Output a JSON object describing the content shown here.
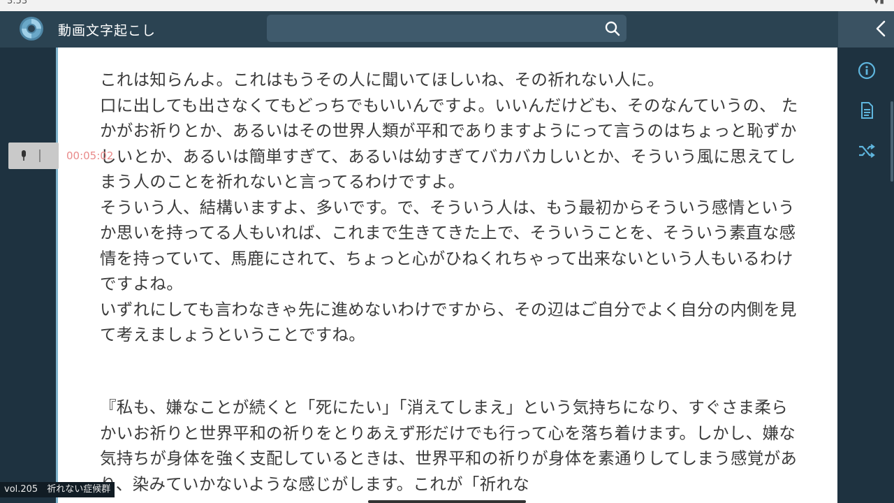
{
  "status_bar": {
    "time": "3:53"
  },
  "header": {
    "app_title": "動画文字起こし",
    "search_placeholder": ""
  },
  "player": {
    "timestamp": "00:05:02"
  },
  "footer": {
    "episode_label": "vol.205　祈れない症候群"
  },
  "transcript": {
    "paragraph1": "これは知らんよ。これはもうその人に聞いてほしいね、その祈れない人に。\n口に出しても出さなくてもどっちでもいいんですよ。いいんだけども、そのなんていうの、 たかがお祈りとか、あるいはその世界人類が平和でありますようにって言うのはちょっと恥ずかしいとか、あるいは簡単すぎて、あるいは幼すぎてバカバカしいとか、そういう風に思えてしまう人のことを祈れないと言ってるわけですよ。\nそういう人、結構いますよ、多いです。で、そういう人は、もう最初からそういう感情というか思いを持ってる人もいれば、これまで生きてきた上で、そういうことを、そういう素直な感情を持っていて、馬鹿にされて、ちょっと心がひねくれちゃって出来ないという人もいるわけですよね。\nいずれにしても言わなきゃ先に進めないわけですから、その辺はご自分でよく自分の内側を見て考えましょうということですね。",
    "paragraph2": "『私も、嫌なことが続くと「死にたい」「消えてしまえ」という気持ちになり、すぐさま柔らかいお祈りと世界平和の祈りをとりあえず形だけでも行って心を落ち着けます。しかし、嫌な気持ちが身体を強く支配しているときは、世界平和の祈りが身体を素通りしてしまう感覚があり、染みていかないような感じがします。これが「祈れな"
  },
  "icons": {
    "logo": "app-logo",
    "search": "search-icon",
    "back": "chevron-left-icon",
    "mic": "mic-icon",
    "info": "info-icon",
    "document": "document-icon",
    "shuffle": "shuffle-icon"
  },
  "colors": {
    "header_bg": "#2b4352",
    "panel_bg": "#1e3240",
    "accent": "#7fb3cc",
    "timestamp": "#e98a8a"
  }
}
